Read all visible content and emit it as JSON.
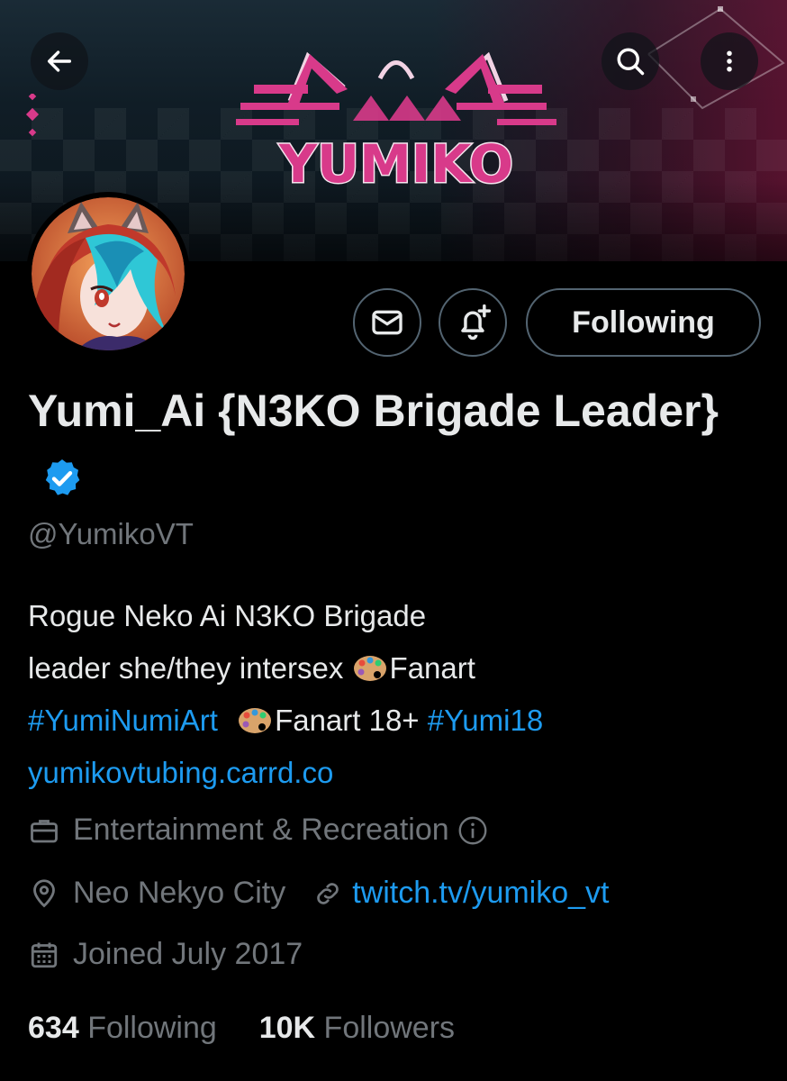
{
  "header": {
    "banner_logo_text": "YUMIKO",
    "back_label": "Back",
    "search_label": "Search",
    "more_label": "More"
  },
  "actions": {
    "follow_label": "Following"
  },
  "profile": {
    "name": "Yumi_Ai {N3KO Brigade Leader}",
    "handle": "@YumikoVT",
    "bio": {
      "line1": "Rogue Neko Ai N3KO Brigade",
      "line2_text": "leader  she/they intersex ",
      "line2_fanart": "Fanart",
      "line3_hashtag1": "#YumiNumiArt",
      "line3_fanart18": "Fanart 18+ ",
      "line3_hashtag2": "#Yumi18",
      "line4_link": "yumikovtubing.carrd.co"
    },
    "category": "Entertainment & Recreation",
    "location": "Neo Nekyo City",
    "website": "twitch.tv/yumiko_vt",
    "joined": "Joined July 2017",
    "following_count": "634",
    "following_label": "Following",
    "followers_count": "10K",
    "followers_label": "Followers"
  },
  "colors": {
    "background": "#000000",
    "text": "#e7e9ea",
    "muted": "#71767b",
    "link": "#1d9bf0",
    "verified": "#1d9bf0",
    "logo_pink": "#d83a8a"
  },
  "icons": {
    "back": "arrow-left-icon",
    "search": "search-icon",
    "more": "more-vertical-icon",
    "message": "envelope-icon",
    "notify": "bell-plus-icon",
    "verified": "verified-badge-icon",
    "category": "briefcase-icon",
    "info": "info-icon",
    "location": "location-pin-icon",
    "link": "link-icon",
    "calendar": "calendar-icon",
    "palette": "palette-emoji-icon"
  }
}
